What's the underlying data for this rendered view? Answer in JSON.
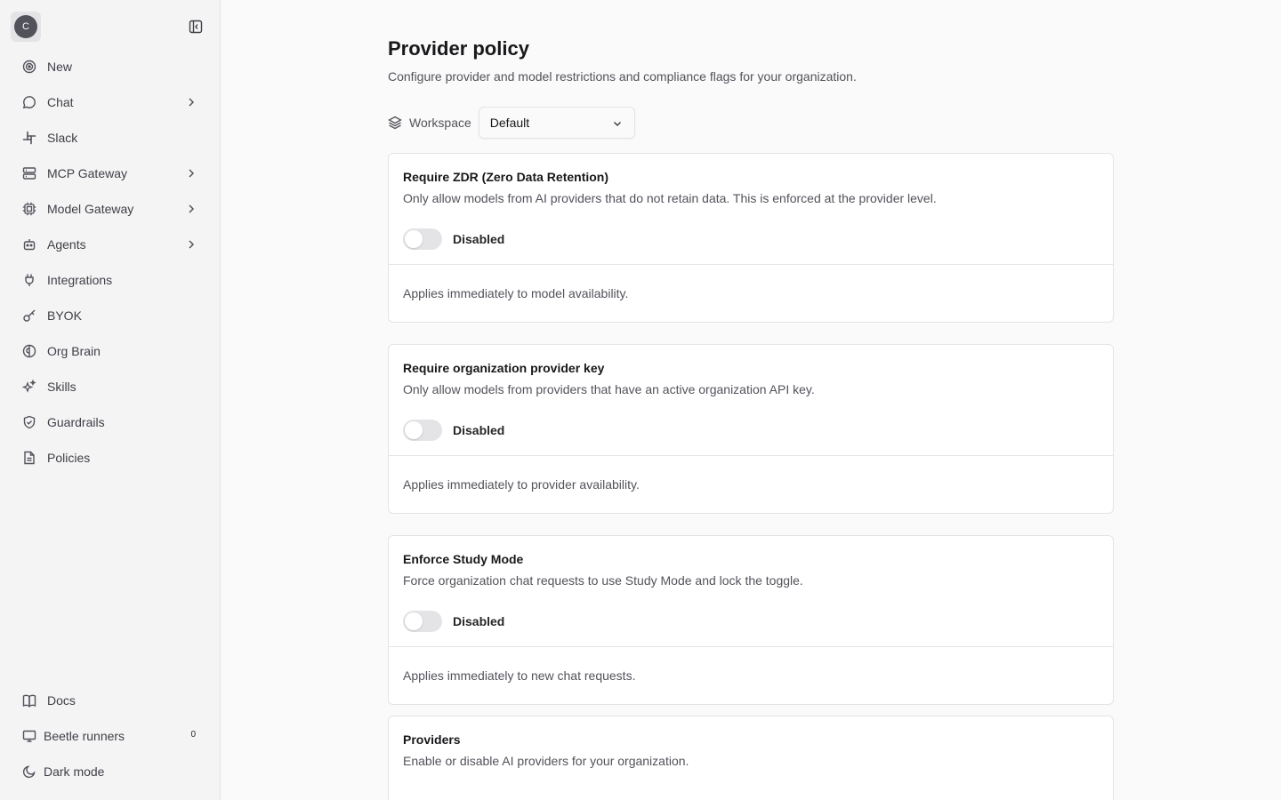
{
  "sidebar": {
    "avatar_initial": "C",
    "items": [
      {
        "label": "New",
        "icon": "target-icon",
        "has_children": false
      },
      {
        "label": "Chat",
        "icon": "chat-bubble-icon",
        "has_children": true
      },
      {
        "label": "Slack",
        "icon": "slack-icon",
        "has_children": false
      },
      {
        "label": "MCP Gateway",
        "icon": "server-icon",
        "has_children": true
      },
      {
        "label": "Model Gateway",
        "icon": "cpu-icon",
        "has_children": true
      },
      {
        "label": "Agents",
        "icon": "bot-icon",
        "has_children": true
      },
      {
        "label": "Integrations",
        "icon": "plug-icon",
        "has_children": false
      },
      {
        "label": "BYOK",
        "icon": "key-icon",
        "has_children": false
      },
      {
        "label": "Org Brain",
        "icon": "brain-icon",
        "has_children": false
      },
      {
        "label": "Skills",
        "icon": "sparkles-icon",
        "has_children": false
      },
      {
        "label": "Guardrails",
        "icon": "shield-check-icon",
        "has_children": false
      },
      {
        "label": "Policies",
        "icon": "document-icon",
        "has_children": false
      }
    ],
    "bottom": {
      "docs": "Docs",
      "runners": "Beetle runners",
      "runners_count": "0",
      "dark_mode": "Dark mode"
    }
  },
  "page": {
    "title": "Provider policy",
    "subtitle": "Configure provider and model restrictions and compliance flags for your organization.",
    "workspace_label": "Workspace",
    "workspace_value": "Default"
  },
  "cards": [
    {
      "title": "Require ZDR (Zero Data Retention)",
      "description": "Only allow models from AI providers that do not retain data. This is enforced at the provider level.",
      "toggle_state": "Disabled",
      "enabled": false,
      "footer": "Applies immediately to model availability."
    },
    {
      "title": "Require organization provider key",
      "description": "Only allow models from providers that have an active organization API key.",
      "toggle_state": "Disabled",
      "enabled": false,
      "footer": "Applies immediately to provider availability."
    },
    {
      "title": "Enforce Study Mode",
      "description": "Force organization chat requests to use Study Mode and lock the toggle.",
      "toggle_state": "Disabled",
      "enabled": false,
      "footer": "Applies immediately to new chat requests."
    }
  ],
  "providers": {
    "title": "Providers",
    "description": "Enable or disable AI providers for your organization."
  },
  "colors": {
    "sidebar_bg": "#f4f4f5",
    "main_bg": "#fafafa",
    "border": "#e4e4e7",
    "text_primary": "#18181b",
    "text_muted": "#52525b",
    "toggle_off": "#e4e4e7"
  }
}
